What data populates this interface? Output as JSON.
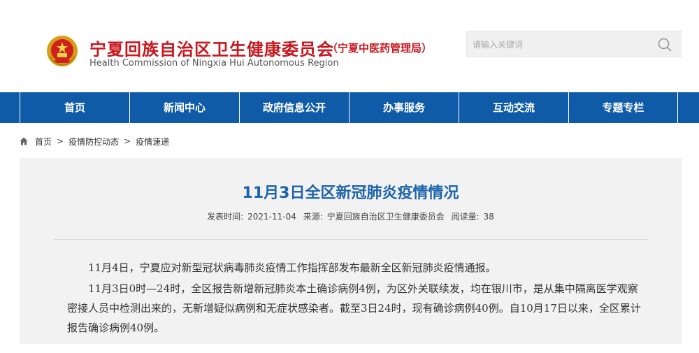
{
  "header": {
    "title": "宁夏回族自治区卫生健康委员会",
    "subtitle": "（宁夏中医药管理局）",
    "title_en": "Health Commission of Ningxia Hui Autonomous Region",
    "accent_color": "#c8161d"
  },
  "search": {
    "placeholder": "请输入关键词",
    "icon": "search-icon"
  },
  "nav": {
    "color": "#0f5ba8",
    "items": [
      {
        "label": "首页"
      },
      {
        "label": "新闻中心"
      },
      {
        "label": "政府信息公开"
      },
      {
        "label": "办事服务"
      },
      {
        "label": "互动交流"
      },
      {
        "label": "专题专栏"
      }
    ]
  },
  "breadcrumb": {
    "icon": "home-icon",
    "items": [
      "首页",
      "疫情防控动态",
      "疫情速递"
    ],
    "separator": ">"
  },
  "article": {
    "title": "11月3日全区新冠肺炎疫情情况",
    "title_color": "#1d64ac",
    "publish_label": "发表时间:",
    "publish_date": "2021-11-04",
    "source_label": "来源:",
    "source": "宁夏回族自治区卫生健康委员会",
    "views_label": "阅读量:",
    "views": "38",
    "paragraphs": [
      "11月4日，宁夏应对新型冠状病毒肺炎疫情工作指挥部发布最新全区新冠肺炎疫情通报。",
      "11月3日0时—24时，全区报告新增新冠肺炎本土确诊病例4例，为区外关联续发，均在银川市，是从集中隔离医学观察密接人员中检测出来的，无新增疑似病例和无症状感染者。截至3日24时，现有确诊病例40例。自10月17日以来，全区累计报告确诊病例40例。"
    ]
  }
}
